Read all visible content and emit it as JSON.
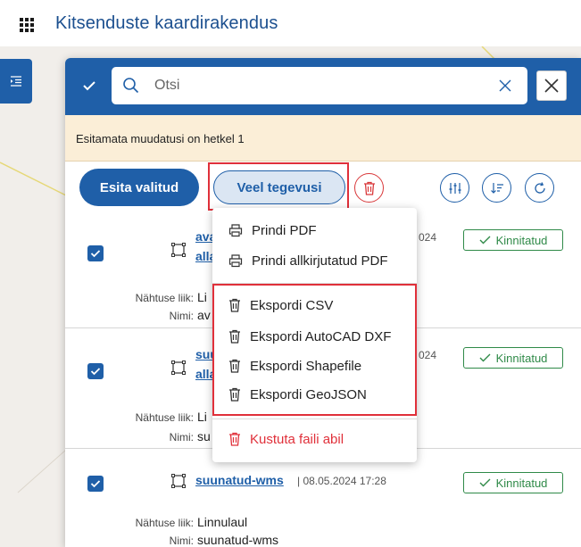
{
  "app": {
    "title": "Kitsenduste kaardirakendus"
  },
  "search": {
    "placeholder": "Otsi",
    "value": ""
  },
  "notice": {
    "text": "Esitamata muudatusi on hetkel 1"
  },
  "toolbar": {
    "submit_label": "Esita valitud",
    "more_label": "Veel tegevusi"
  },
  "rows": [
    {
      "name_line1": "ava",
      "name_line2": "alla",
      "date_tail": "024",
      "status": "Kinnitatud",
      "type_label": "Nähtuse liik:",
      "type_value": "Li",
      "name_label": "Nimi:",
      "name_value": "av"
    },
    {
      "name_line1": "suu",
      "name_line2": "alla",
      "date_tail": "024",
      "status": "Kinnitatud",
      "type_label": "Nähtuse liik:",
      "type_value": "Li",
      "name_label": "Nimi:",
      "name_value": "su"
    },
    {
      "name_line1": "suunatud-wms",
      "date": "| 08.05.2024 17:28",
      "status": "Kinnitatud",
      "type_label": "Nähtuse liik:",
      "type_value": "Linnulaul",
      "name_label": "Nimi:",
      "name_value": "suunatud-wms"
    }
  ],
  "menu": {
    "print_pdf": "Prindi PDF",
    "print_signed_pdf": "Prindi allkirjutatud PDF",
    "export_csv": "Ekspordi CSV",
    "export_dxf": "Ekspordi AutoCAD DXF",
    "export_shapefile": "Ekspordi Shapefile",
    "export_geojson": "Ekspordi GeoJSON",
    "delete_by_file": "Kustuta faili abil"
  },
  "colors": {
    "primary": "#1f5fa8",
    "danger": "#e0303a",
    "success": "#2f8a48",
    "notice_bg": "#fbeed7"
  }
}
